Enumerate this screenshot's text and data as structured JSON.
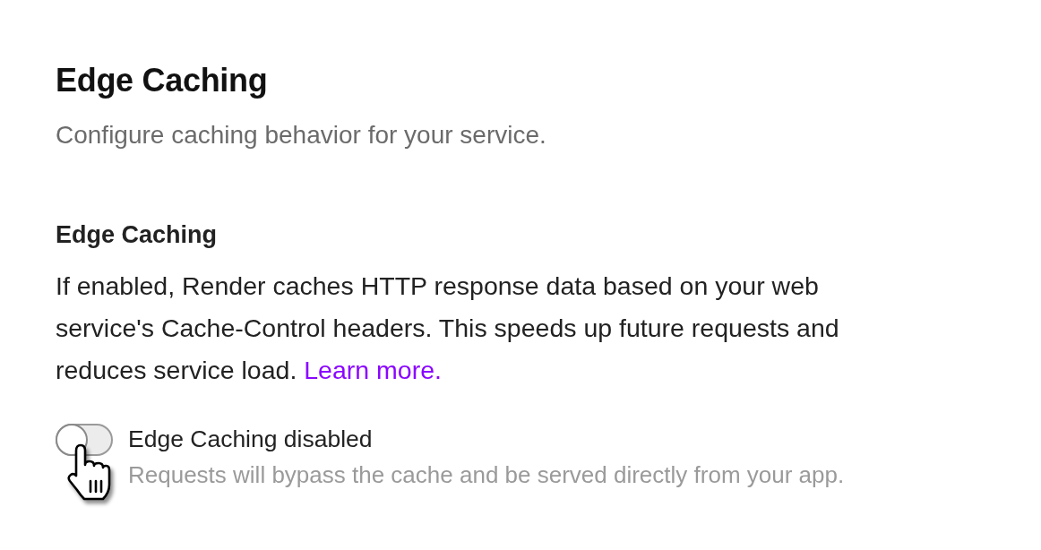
{
  "page": {
    "title": "Edge Caching",
    "subtitle": "Configure caching behavior for your service."
  },
  "section": {
    "heading": "Edge Caching",
    "description": "If enabled, Render caches HTTP response data based on your web service's Cache-Control headers. This speeds up future requests and reduces service load.",
    "link": "Learn more."
  },
  "toggle": {
    "on": false,
    "label": "Edge Caching disabled",
    "hint": "Requests will bypass the cache and be served directly from your app."
  }
}
